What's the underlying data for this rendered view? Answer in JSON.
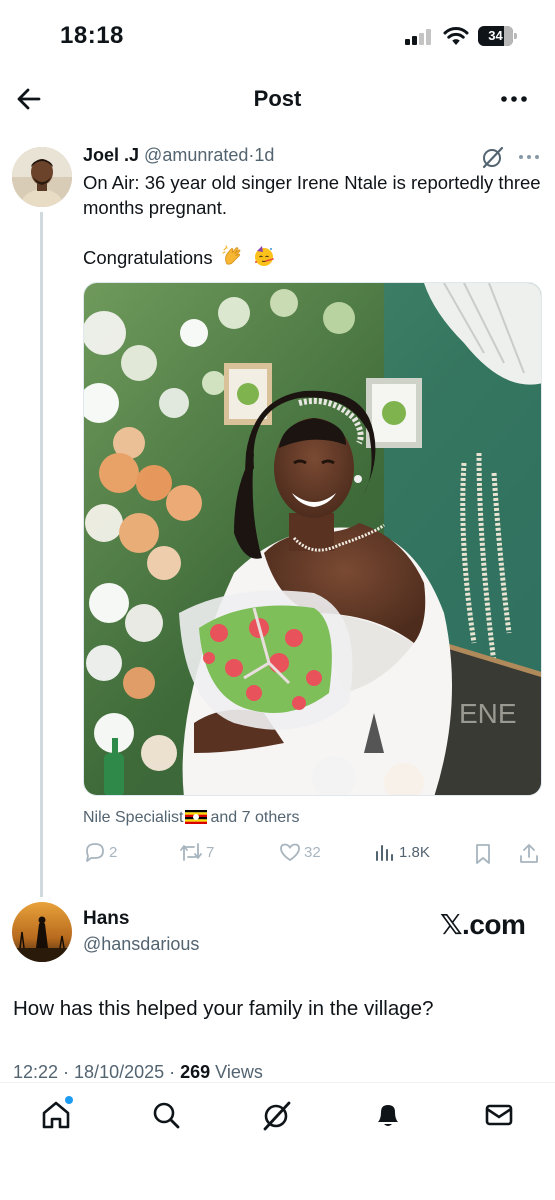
{
  "status_bar": {
    "time": "18:18",
    "battery_level": "34"
  },
  "header": {
    "title": "Post",
    "back_icon": "arrow-left-icon",
    "more_icon": "ellipsis-icon"
  },
  "tweet": {
    "author_name": "Joel .J",
    "author_handle": "@amunrated",
    "separator": "·",
    "time_ago": "1d",
    "text": "On Air: 36 year old singer Irene Ntale is reportedly three months pregnant.",
    "congrats_text": "Congratulations",
    "emojis": [
      "clapping-hands-icon",
      "partying-face-icon"
    ],
    "tagged_first": "Nile Specialist",
    "tagged_flag": "uganda-flag-icon",
    "tagged_rest": "and 7 others",
    "actions": {
      "replies": "2",
      "reposts": "7",
      "likes": "32",
      "views": "1.8K"
    }
  },
  "reply": {
    "name": "Hans",
    "handle": "@hansdarious",
    "watermark": "𝕏.com",
    "text": "How has this helped your family in the village?",
    "time": "12:22 · 18/10/2025 · ",
    "views_count": "269",
    "views_label": " Views"
  },
  "bottom_nav": {
    "items": [
      "home-icon",
      "search-icon",
      "grok-icon",
      "notifications-icon",
      "messages-icon"
    ]
  },
  "colors": {
    "text_primary": "#0f1419",
    "text_secondary": "#536471",
    "accent": "#1d9bf0",
    "divider": "#cfd9de"
  }
}
